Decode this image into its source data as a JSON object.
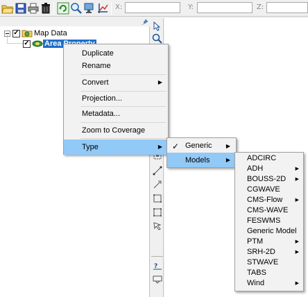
{
  "toolbar": {
    "coord_x_label": "X:",
    "coord_y_label": "Y:",
    "coord_z_label": "Z:",
    "x_value": "",
    "y_value": "",
    "z_value": ""
  },
  "tree": {
    "root": {
      "label": "Map Data",
      "checked": "✓"
    },
    "child": {
      "label": "Area Property",
      "checked": "✓"
    }
  },
  "context_menu": {
    "items": [
      {
        "label": "Duplicate"
      },
      {
        "label": "Rename"
      },
      {
        "label": "Convert"
      },
      {
        "label": "Projection..."
      },
      {
        "label": "Metadata..."
      },
      {
        "label": "Zoom to Coverage"
      },
      {
        "label": "Type"
      }
    ]
  },
  "type_menu": {
    "items": [
      {
        "label": "Generic",
        "checked": "✓"
      },
      {
        "label": "Models"
      }
    ]
  },
  "models_menu": {
    "items": [
      {
        "label": "ADCIRC"
      },
      {
        "label": "ADH"
      },
      {
        "label": "BOUSS-2D"
      },
      {
        "label": "CGWAVE"
      },
      {
        "label": "CMS-Flow"
      },
      {
        "label": "CMS-WAVE"
      },
      {
        "label": "FESWMS"
      },
      {
        "label": "Generic Model"
      },
      {
        "label": "PTM"
      },
      {
        "label": "SRH-2D"
      },
      {
        "label": "STWAVE"
      },
      {
        "label": "TABS"
      },
      {
        "label": "Wind"
      }
    ]
  },
  "colors": {
    "selection": "#1e6ec8",
    "menu_highlight": "#91c9f7",
    "menu_hover": "#cce8ff"
  }
}
